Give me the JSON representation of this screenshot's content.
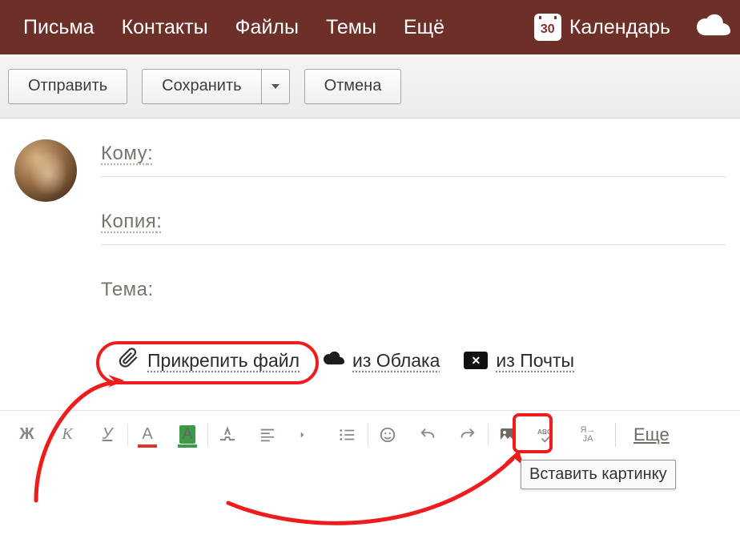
{
  "nav": {
    "items": [
      "Письма",
      "Контакты",
      "Файлы",
      "Темы",
      "Ещё"
    ],
    "calendar_day": "30",
    "calendar_label": "Календарь"
  },
  "actions": {
    "send": "Отправить",
    "save": "Сохранить",
    "cancel": "Отмена"
  },
  "fields": {
    "to": "Кому",
    "cc": "Копия",
    "subject": "Тема"
  },
  "attach": {
    "file": "Прикрепить файл",
    "cloud": "из Облака",
    "mail": "из Почты"
  },
  "format_toolbar": {
    "bold": "Ж",
    "italic": "К",
    "underline": "У",
    "text_color": "A",
    "highlight": "A",
    "more": "Еще"
  },
  "tooltip": {
    "insert_image": "Вставить картинку"
  },
  "annotation_colors": {
    "highlight": "#ee1c1c"
  }
}
